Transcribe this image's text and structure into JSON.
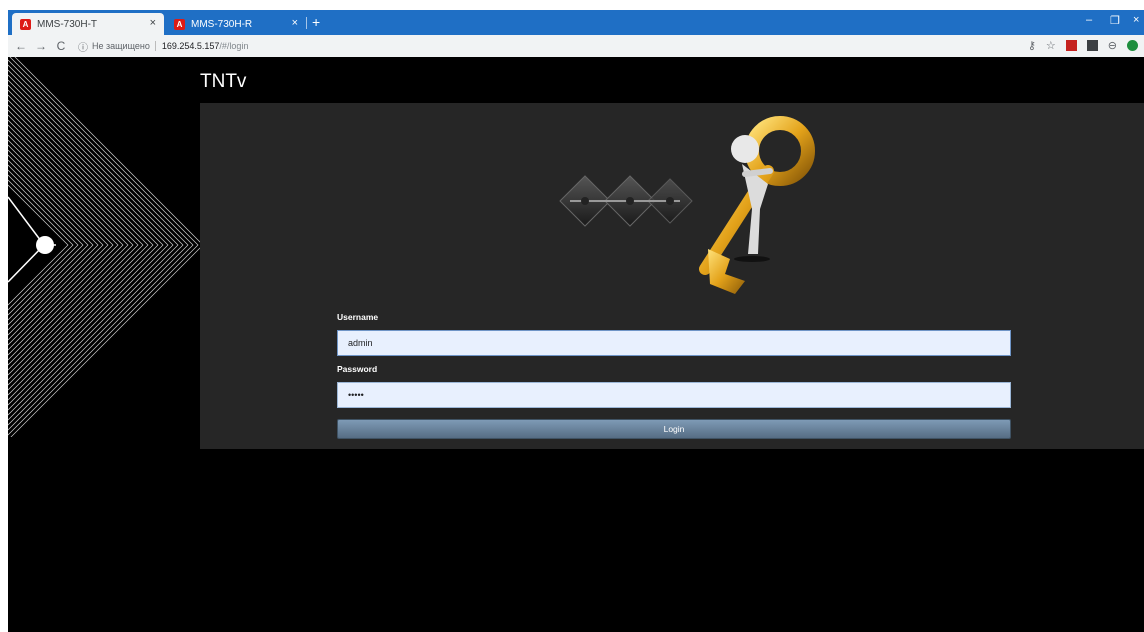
{
  "browser": {
    "tabs": [
      {
        "title": "MMS-730H-T",
        "favicon": "A",
        "active": true
      },
      {
        "title": "MMS-730H-R",
        "favicon": "A",
        "active": false
      }
    ],
    "close_glyph": "×",
    "new_tab_glyph": "+",
    "window_controls": {
      "minimize": "–",
      "restore": "❐",
      "close": "×"
    },
    "nav": {
      "back": "←",
      "forward": "→",
      "reload": "C"
    },
    "address": {
      "info_icon": "ⓘ",
      "security": "Не защищено",
      "host": "169.254.5.157",
      "path": "/#/login"
    },
    "toolbar_icons": {
      "key": "⚷",
      "star": "☆",
      "profile": "⊖"
    }
  },
  "page": {
    "brand": "TNTv",
    "username": {
      "label": "Username",
      "value": "admin"
    },
    "password": {
      "label": "Password",
      "value": "•••••"
    },
    "login_button": "Login"
  },
  "colors": {
    "tabstrip": "#1f6fc5",
    "panel": "#262626",
    "input_bg": "#e8f0fe",
    "button": "#6a859f"
  }
}
